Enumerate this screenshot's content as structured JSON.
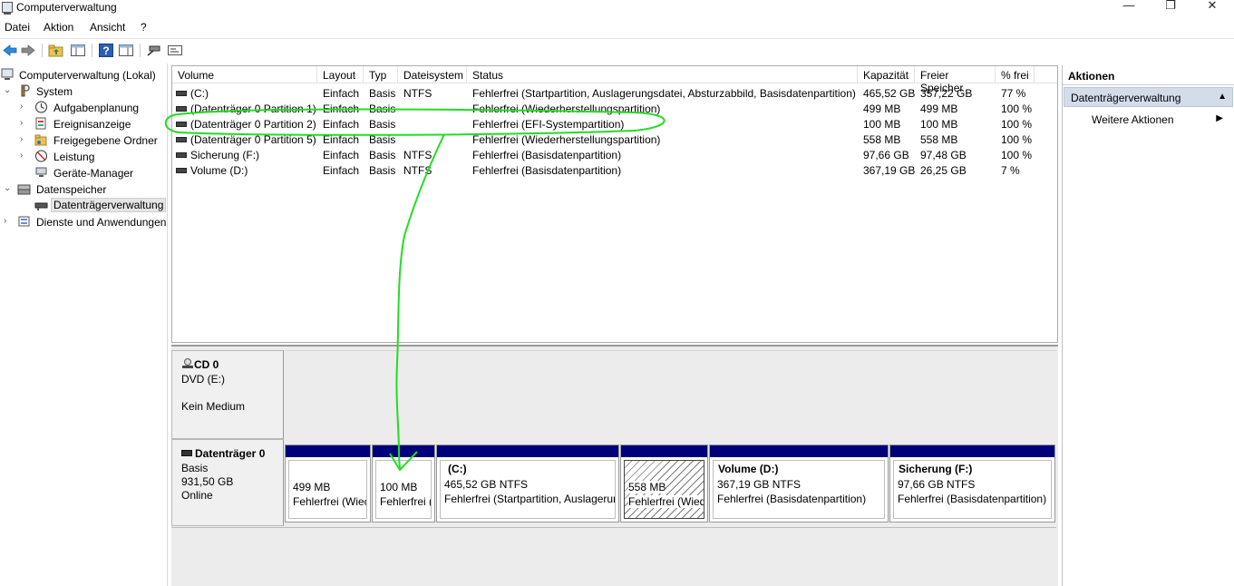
{
  "window": {
    "title": "Computerverwaltung",
    "minimize": "—",
    "restore": "❐",
    "close": "✕"
  },
  "menu": [
    "Datei",
    "Aktion",
    "Ansicht",
    "?"
  ],
  "toolbar": {
    "buttons": [
      "back-icon",
      "forward-icon",
      "up-folder-icon",
      "show-hide-tree-icon",
      "help-icon",
      "properties-icon",
      "connect-disk-icon",
      "console-icon"
    ]
  },
  "tree": {
    "root": "Computerverwaltung (Lokal)",
    "system": "System",
    "aufgabenplanung": "Aufgabenplanung",
    "ereignisanzeige": "Ereignisanzeige",
    "freigegebene_ordner": "Freigegebene Ordner",
    "leistung": "Leistung",
    "geraete_manager": "Geräte-Manager",
    "datenspeicher": "Datenspeicher",
    "datentraegerverwaltung": "Datenträgerverwaltung",
    "dienste": "Dienste und Anwendungen"
  },
  "columns": {
    "volume": "Volume",
    "layout": "Layout",
    "typ": "Typ",
    "dateisystem": "Dateisystem",
    "status": "Status",
    "kapazitaet": "Kapazität",
    "freier_speicher": "Freier Speicher",
    "prozent_frei": "% frei"
  },
  "volumes": [
    {
      "volume": "(C:)",
      "layout": "Einfach",
      "typ": "Basis",
      "dateisystem": "NTFS",
      "status": "Fehlerfrei (Startpartition, Auslagerungsdatei, Absturzabbild, Basisdatenpartition)",
      "kapazitaet": "465,52 GB",
      "frei": "357,22 GB",
      "prozent": "77 %"
    },
    {
      "volume": "(Datenträger 0 Partition 1)",
      "layout": "Einfach",
      "typ": "Basis",
      "dateisystem": "",
      "status": "Fehlerfrei (Wiederherstellungspartition)",
      "kapazitaet": "499 MB",
      "frei": "499 MB",
      "prozent": "100 %"
    },
    {
      "volume": "(Datenträger 0 Partition 2)",
      "layout": "Einfach",
      "typ": "Basis",
      "dateisystem": "",
      "status": "Fehlerfrei (EFI-Systempartition)",
      "kapazitaet": "100 MB",
      "frei": "100 MB",
      "prozent": "100 %"
    },
    {
      "volume": "(Datenträger 0 Partition 5)",
      "layout": "Einfach",
      "typ": "Basis",
      "dateisystem": "",
      "status": "Fehlerfrei (Wiederherstellungspartition)",
      "kapazitaet": "558 MB",
      "frei": "558 MB",
      "prozent": "100 %"
    },
    {
      "volume": "Sicherung (F:)",
      "layout": "Einfach",
      "typ": "Basis",
      "dateisystem": "NTFS",
      "status": "Fehlerfrei (Basisdatenpartition)",
      "kapazitaet": "97,66 GB",
      "frei": "97,48 GB",
      "prozent": "100 %"
    },
    {
      "volume": "Volume (D:)",
      "layout": "Einfach",
      "typ": "Basis",
      "dateisystem": "NTFS",
      "status": "Fehlerfrei (Basisdatenpartition)",
      "kapazitaet": "367,19 GB",
      "frei": "26,25 GB",
      "prozent": "7 %"
    }
  ],
  "cd": {
    "name": "CD 0",
    "line1": "DVD (E:)",
    "line2": "Kein Medium"
  },
  "disk0": {
    "name": "Datenträger 0",
    "line1": "Basis",
    "line2": "931,50 GB",
    "line3": "Online"
  },
  "partitions": [
    {
      "title": "",
      "size": "499 MB",
      "status": "Fehlerfrei (Wiec"
    },
    {
      "title": "",
      "size": "100 MB",
      "status": "Fehlerfrei ("
    },
    {
      "title": "(C:)",
      "size": "465,52 GB NTFS",
      "status": "Fehlerfrei (Startpartition, Auslagerur"
    },
    {
      "title": "",
      "size": "558 MB",
      "status": "Fehlerfrei (Wied"
    },
    {
      "title": "Volume  (D:)",
      "size": "367,19 GB NTFS",
      "status": "Fehlerfrei (Basisdatenpartition)"
    },
    {
      "title": "Sicherung  (F:)",
      "size": "97,66 GB NTFS",
      "status": "Fehlerfrei (Basisdatenpartition)"
    }
  ],
  "actions": {
    "header": "Aktionen",
    "section": "Datenträgerverwaltung",
    "more": "Weitere Aktionen"
  },
  "colors": {
    "partition_bar": "#00007b",
    "annotation": "#22dd22",
    "selection": "#d4dcea"
  }
}
